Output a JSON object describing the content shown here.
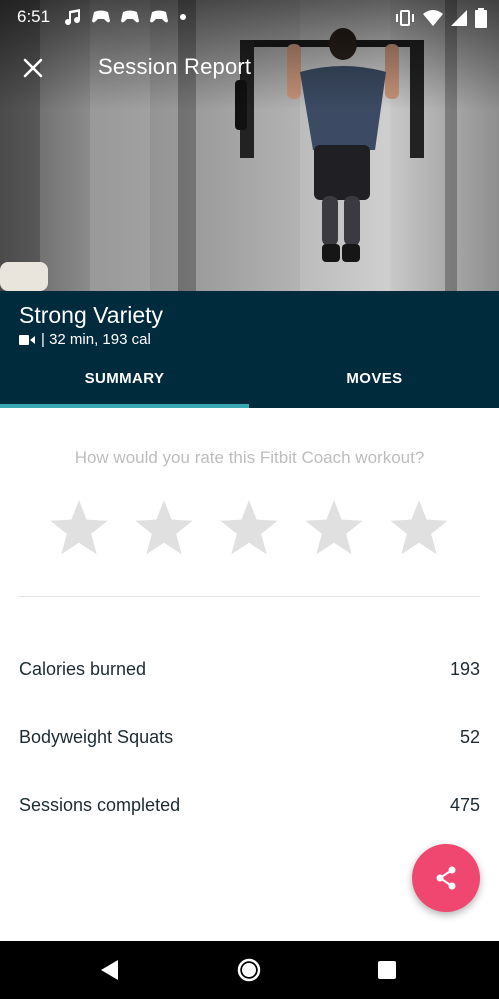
{
  "status_bar": {
    "time": "6:51",
    "icons": [
      "music-note-icon",
      "game-controller-icon",
      "game-controller-icon",
      "game-controller-icon",
      "dot-icon"
    ],
    "right_icons": [
      "vibrate-icon",
      "wifi-icon",
      "signal-icon",
      "battery-icon"
    ]
  },
  "header": {
    "title": "Session Report",
    "close_icon": "close-icon"
  },
  "workout": {
    "name": "Strong Variety",
    "meta": "| 32 min, 193 cal",
    "meta_icon": "video-camera-icon"
  },
  "tabs": [
    {
      "label": "SUMMARY",
      "active": true
    },
    {
      "label": "MOVES",
      "active": false
    }
  ],
  "rating": {
    "question": "How would you rate this Fitbit Coach workout?",
    "max_stars": 5,
    "selected": 0
  },
  "stats": [
    {
      "label": "Calories burned",
      "value": "193"
    },
    {
      "label": "Bodyweight Squats",
      "value": "52"
    },
    {
      "label": "Sessions completed",
      "value": "475"
    }
  ],
  "fab": {
    "icon": "share-icon"
  },
  "nav": [
    "back-icon",
    "home-icon",
    "recents-icon"
  ],
  "colors": {
    "header_band": "#002b3d",
    "tab_indicator": "#3aa8b3",
    "fab": "#ef476f",
    "star": "#e0e0e0"
  }
}
